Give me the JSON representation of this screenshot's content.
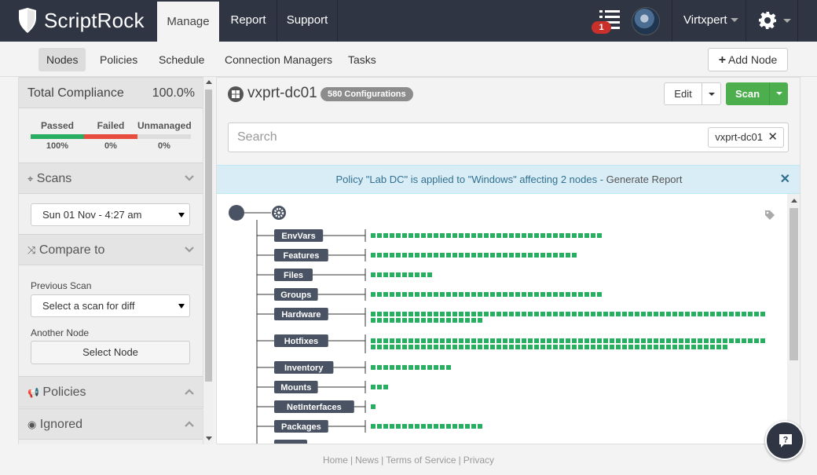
{
  "brand": {
    "name": "ScriptRock"
  },
  "topnav": {
    "tabs": [
      {
        "label": "Manage",
        "active": true
      },
      {
        "label": "Report",
        "active": false
      },
      {
        "label": "Support",
        "active": false
      }
    ],
    "notification_count": "1",
    "user_name": "Virtxpert"
  },
  "subnav": {
    "tabs": [
      {
        "label": "Nodes",
        "active": true
      },
      {
        "label": "Policies",
        "active": false
      },
      {
        "label": "Schedule",
        "active": false
      },
      {
        "label": "Connection Managers",
        "active": false
      },
      {
        "label": "Tasks",
        "active": false
      }
    ],
    "add_node_label": "Add Node"
  },
  "sidebar": {
    "compliance": {
      "label": "Total Compliance",
      "value": "100.0%",
      "stats": [
        {
          "label": "Passed",
          "value": "100%",
          "fraction": 1.0,
          "color": "#27ae60"
        },
        {
          "label": "Failed",
          "value": "0%",
          "fraction": 0.0,
          "color": "#e74c3c"
        },
        {
          "label": "Unmanaged",
          "value": "0%",
          "fraction": 0.0,
          "color": "#dddddd"
        }
      ]
    },
    "scans": {
      "title": "Scans",
      "selected": "Sun 01 Nov - 4:27 am"
    },
    "compare": {
      "title": "Compare to",
      "previous_label": "Previous Scan",
      "previous_selected": "Select a scan for diff",
      "another_label": "Another Node",
      "select_node_label": "Select Node"
    },
    "policies_title": "Policies",
    "ignored_title": "Ignored"
  },
  "main": {
    "node_name": "vxprt-dc01",
    "config_badge": "580 Configurations",
    "edit_label": "Edit",
    "scan_label": "Scan",
    "search_placeholder": "Search",
    "search_chip": "vxprt-dc01",
    "alert": {
      "text": "Policy \"Lab DC\" is applied to \"Windows\" affecting 2 nodes - ",
      "link": "Generate Report"
    },
    "categories": [
      {
        "label": "EnvVars",
        "count": 37
      },
      {
        "label": "Features",
        "count": 33
      },
      {
        "label": "Files",
        "count": 10
      },
      {
        "label": "Groups",
        "count": 37
      },
      {
        "label": "Hardware",
        "count": 81
      },
      {
        "label": "Hotfixes",
        "count": 120
      },
      {
        "label": "Inventory",
        "count": 13
      },
      {
        "label": "Mounts",
        "count": 3
      },
      {
        "label": "NetInterfaces",
        "count": 1
      },
      {
        "label": "Packages",
        "count": 18
      }
    ],
    "accent_color": "#27ae60"
  },
  "footer": {
    "links": [
      "Home",
      "News",
      "Terms of Service",
      "Privacy"
    ]
  }
}
